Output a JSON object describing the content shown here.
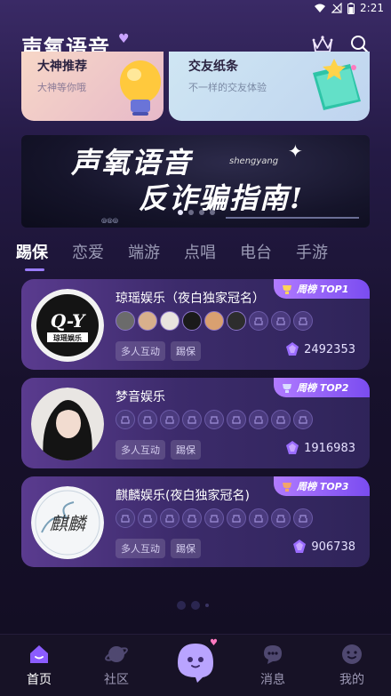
{
  "status_bar": {
    "time": "2:21"
  },
  "header": {
    "title": "声氧语音"
  },
  "promos": [
    {
      "title": "大神推荐",
      "subtitle": "大神等你哦"
    },
    {
      "title": "交友纸条",
      "subtitle": "不一样的交友体验"
    }
  ],
  "banner": {
    "line1": "声氧语音",
    "line2": "反诈骗指南!",
    "pinyin": "shengyang",
    "dots_active": 1
  },
  "tabs": [
    "踢保",
    "恋爱",
    "端游",
    "点唱",
    "电台",
    "手游"
  ],
  "rooms": [
    {
      "name": "琼瑶娱乐（夜白独家冠名）",
      "rank": "周榜 TOP1",
      "tags": [
        "多人互动",
        "踢保"
      ],
      "popularity": "2492353",
      "filled_seats": 6,
      "total_seats": 9,
      "avatar_text": "Q-Y",
      "avatar_subtext": "琼瑶娱乐"
    },
    {
      "name": "梦音娱乐",
      "rank": "周榜 TOP2",
      "tags": [
        "多人互动",
        "踢保"
      ],
      "popularity": "1916983",
      "filled_seats": 0,
      "total_seats": 9
    },
    {
      "name": "麒麟娱乐(夜白独家冠名)",
      "rank": "周榜 TOP3",
      "tags": [
        "多人互动",
        "踢保"
      ],
      "popularity": "906738",
      "filled_seats": 0,
      "total_seats": 9,
      "avatar_text": "麒麟"
    }
  ],
  "bottom_nav": [
    {
      "label": "首页",
      "icon": "home-icon",
      "active": true
    },
    {
      "label": "社区",
      "icon": "planet-icon",
      "active": false
    },
    {
      "label": "",
      "icon": "ghost-icon",
      "active": false
    },
    {
      "label": "消息",
      "icon": "message-icon",
      "active": false
    },
    {
      "label": "我的",
      "icon": "profile-icon",
      "active": false
    }
  ],
  "colors": {
    "accent": "#9a7cff",
    "card_start": "#5a3b8f",
    "card_end": "#2f2459",
    "background": "#17112c"
  }
}
